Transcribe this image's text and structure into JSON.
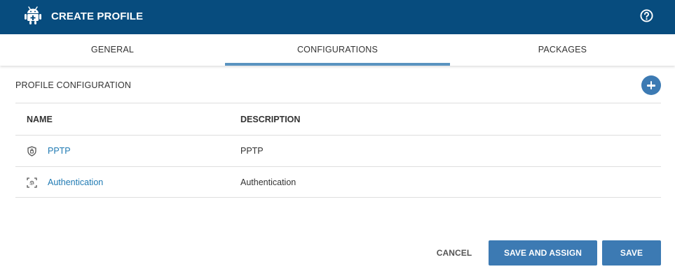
{
  "header": {
    "title": "CREATE PROFILE",
    "logo_icon": "android-icon",
    "help_icon": "help-circle-icon",
    "background": "#074c7e"
  },
  "tabs": [
    {
      "label": "GENERAL",
      "active": false
    },
    {
      "label": "CONFIGURATIONS",
      "active": true
    },
    {
      "label": "PACKAGES",
      "active": false
    }
  ],
  "section": {
    "title": "PROFILE CONFIGURATION",
    "add_icon": "plus-circle-icon"
  },
  "table": {
    "columns": [
      "NAME",
      "DESCRIPTION"
    ],
    "rows": [
      {
        "name": "PPTP",
        "description": "PPTP",
        "icon": "shield-icon"
      },
      {
        "name": "Authentication",
        "description": "Authentication",
        "icon": "fingerprint-scan-icon"
      }
    ]
  },
  "footer": {
    "cancel_label": "CANCEL",
    "save_assign_label": "SAVE AND ASSIGN",
    "save_label": "SAVE"
  },
  "colors": {
    "accent": "#3c7ab3",
    "link": "#1f7ab3"
  }
}
